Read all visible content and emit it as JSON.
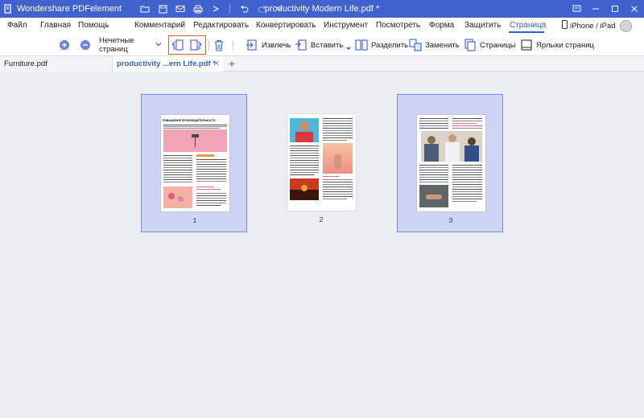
{
  "app": {
    "name": "Wondershare PDFelement",
    "window_title": "productivity Modern Life.pdf *"
  },
  "quick_access_icons": [
    "folder-icon",
    "save-icon",
    "email-icon",
    "print-icon",
    "pointer-icon",
    "undo-icon",
    "redo-icon",
    "dropdown-icon"
  ],
  "menu": {
    "items": [
      "Файл",
      "Главная",
      "Помощь",
      "Комментарий",
      "Редактировать",
      "Конвертировать",
      "Инструмент",
      "Посмотреть",
      "Форма",
      "Защитить",
      "Страница"
    ],
    "active": "Страница",
    "device_link": "iPhone / iPad"
  },
  "toolbar": {
    "page_range_value": "Нечетные страниц",
    "extract_label": "Извлечь",
    "insert_label": "Вставить",
    "split_label": "Разделить",
    "replace_label": "Заменить",
    "pages_label": "Страницы",
    "labels_label": "Ярлыки страниц"
  },
  "tabs": {
    "items": [
      {
        "label": "Furniture.pdf",
        "active": false
      },
      {
        "label": "productivity ...ern Life.pdf *",
        "active": true
      }
    ]
  },
  "pages": [
    {
      "number": "1",
      "selected": true,
      "heading": "ПОВЫШЕНИЕ ПРОИЗВОДИТЕЛЬНОСТИ"
    },
    {
      "number": "2",
      "selected": false
    },
    {
      "number": "3",
      "selected": true
    }
  ],
  "colors": {
    "titlebar": "#3f62cf",
    "accent": "#3a5fcf",
    "selection_fill": "#cdd3f4",
    "selection_border": "#7d8ee0",
    "highlight": "#d9622b",
    "canvas": "#ecedf2"
  }
}
